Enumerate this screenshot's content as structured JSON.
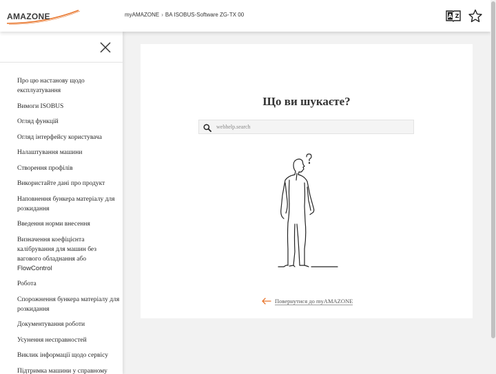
{
  "header": {
    "logo_text": "AMAZONE",
    "breadcrumb": [
      "myAMAZONE",
      "BA ISOBUS-Software ZG-TX 00"
    ],
    "breadcrumb_sep": "›",
    "icons": [
      "glossary-icon",
      "favorite-star-icon"
    ]
  },
  "sidebar": {
    "close_icon": "close-icon",
    "items": [
      "Про цю настанову щодо експлуатування",
      "Вимоги ISOBUS",
      "Огляд функцій",
      "Огляд інтерфейсу користувача",
      "Налаштування машини",
      "Створення профілів",
      "Використайте дані про продукт",
      "Наповнення бункера матеріалу для розкидання",
      "Введення норми внесення",
      "Визначення коефіцієнта калібрування для машин без вагового обладнання або",
      "Робота",
      "Спорожнення бункера матеріалу для розкидання",
      "Документування роботи",
      "Усунення несправностей",
      "Виклик інформації щодо сервісу",
      "Підтримка машини у справному"
    ],
    "item_suffix_flowcontrol": "FlowControl"
  },
  "main": {
    "title": "Що ви шукаєте?",
    "search_placeholder": "webhelp.search",
    "figure_icon": "thinking-person-illustration",
    "back_link": "Повернутися до myAMAZONE"
  },
  "colors": {
    "accent": "#e8742a",
    "background": "#f2f2f2",
    "text": "#222222"
  }
}
